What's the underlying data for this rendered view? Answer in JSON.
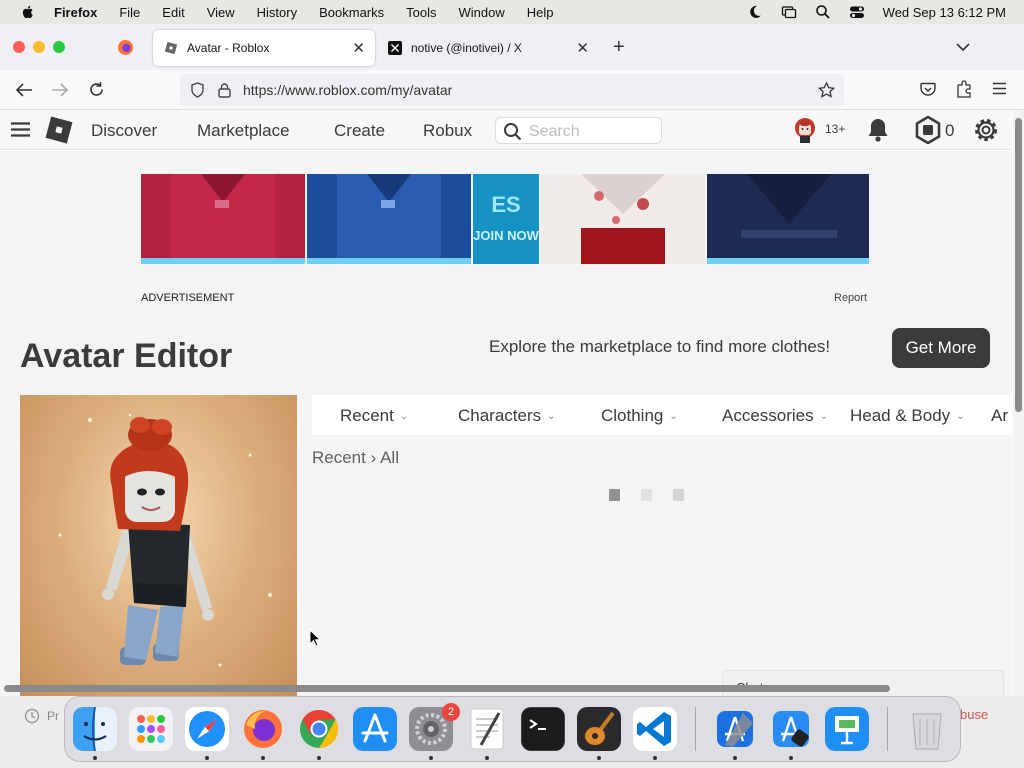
{
  "menubar": {
    "app": "Firefox",
    "items": [
      "File",
      "Edit",
      "View",
      "History",
      "Bookmarks",
      "Tools",
      "Window",
      "Help"
    ],
    "clock": "Wed Sep 13  6:12 PM"
  },
  "browser": {
    "tabs": [
      {
        "title": "Avatar - Roblox",
        "active": true
      },
      {
        "title": "notive (@inotivei) / X",
        "active": false
      }
    ],
    "url_domain": "https://www.roblox.com",
    "url_path": "/my/avatar"
  },
  "roblox": {
    "nav": [
      "Discover",
      "Marketplace",
      "Create",
      "Robux"
    ],
    "search_placeholder": "Search",
    "age_badge": "13+",
    "robux_count": "0",
    "ad_label": "ADVERTISEMENT",
    "report_label": "Report",
    "ad_banner_text": "JOIN NOW",
    "page_title": "Avatar Editor",
    "explore_text": "Explore the marketplace to find more clothes!",
    "get_more_label": "Get More",
    "categories": [
      "Recent",
      "Characters",
      "Clothing",
      "Accessories",
      "Head & Body",
      "Ar"
    ],
    "breadcrumb_root": "Recent",
    "breadcrumb_sep": "›",
    "breadcrumb_current": "All",
    "chat_label": "Chat"
  },
  "dock": {
    "settings_badge": "2",
    "behind_text_left": "Pr",
    "behind_text_right": "buse"
  },
  "colors": {
    "roblox_text": "#393b3d",
    "page_bg": "#f2f4f5",
    "button_dark": "#393b3d",
    "badge_red": "#e8453c"
  }
}
